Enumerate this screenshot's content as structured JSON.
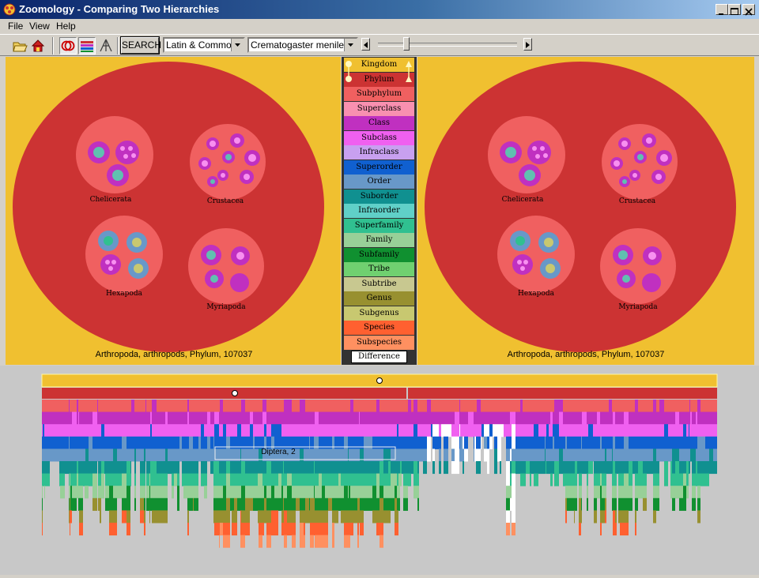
{
  "window": {
    "title": "Zoomology - Comparing Two Hierarchies"
  },
  "menu": [
    {
      "label": "File",
      "key": "F"
    },
    {
      "label": "View",
      "key": "V"
    },
    {
      "label": "Help",
      "key": "H"
    }
  ],
  "toolbar": {
    "search_label": "SEARCH",
    "name_mode": "Latin & Common",
    "taxon": "Crematogaster menilekii",
    "icons": [
      "open-folder-icon",
      "home-icon",
      "compare-rings-icon",
      "color-bars-icon",
      "tree-icon"
    ],
    "zoom_fraction": 0.2
  },
  "left_panel": {
    "caption": "Arthropoda, arthropods, Phylum, 107037",
    "groups": [
      "Chelicerata",
      "Crustacea",
      "Hexapoda",
      "Myriapoda"
    ]
  },
  "right_panel": {
    "caption": "Arthropoda, arthropods, Phylum, 107037",
    "groups": [
      "Chelicerata",
      "Crustacea",
      "Hexapoda",
      "Myriapoda"
    ]
  },
  "legend": {
    "levels": [
      {
        "name": "Kingdom",
        "color": "#f0c030"
      },
      {
        "name": "Phylum",
        "color": "#cc3333"
      },
      {
        "name": "Subphylum",
        "color": "#f06060"
      },
      {
        "name": "Superclass",
        "color": "#f890b0"
      },
      {
        "name": "Class",
        "color": "#c030c0"
      },
      {
        "name": "Subclass",
        "color": "#f060f0"
      },
      {
        "name": "Infraclass",
        "color": "#c8a0f0"
      },
      {
        "name": "Superorder",
        "color": "#1060d0"
      },
      {
        "name": "Order",
        "color": "#6898c8"
      },
      {
        "name": "Suborder",
        "color": "#109090"
      },
      {
        "name": "Infraorder",
        "color": "#60d0c8"
      },
      {
        "name": "Superfamily",
        "color": "#30c090"
      },
      {
        "name": "Family",
        "color": "#98d098"
      },
      {
        "name": "Subfamily",
        "color": "#109030"
      },
      {
        "name": "Tribe",
        "color": "#70d070"
      },
      {
        "name": "Subtribe",
        "color": "#c8c890"
      },
      {
        "name": "Genus",
        "color": "#989030"
      },
      {
        "name": "Subgenus",
        "color": "#c8c870"
      },
      {
        "name": "Species",
        "color": "#ff6030"
      },
      {
        "name": "Subspecies",
        "color": "#ff9060"
      },
      {
        "name": "Difference",
        "color": "#ffffff"
      }
    ]
  },
  "treemap": {
    "highlight_label": "Diptera, 2"
  }
}
